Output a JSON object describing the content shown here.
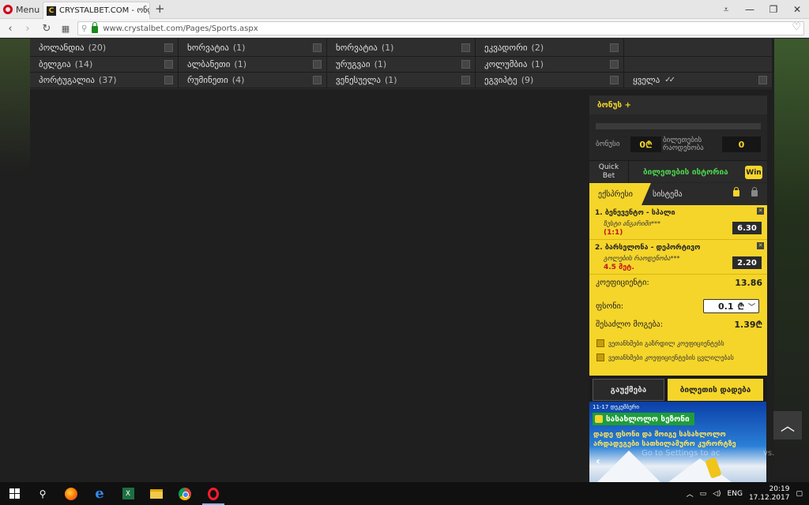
{
  "browser": {
    "menu_label": "Menu",
    "tab_title": "CRYSTALBET.COM - ონლ...",
    "favicon_letter": "C",
    "new_tab": "+",
    "url": "www.crystalbet.com/Pages/Sports.aspx",
    "controls": [
      "⩡",
      "—",
      "❐",
      "✕"
    ]
  },
  "countries": [
    [
      {
        "name": "პოლანდია",
        "count": "(20)"
      },
      {
        "name": "ხორვატია",
        "count": "(1)"
      },
      {
        "name": "ხორვატია",
        "count": "(1)"
      },
      {
        "name": "ეკვადორი",
        "count": "(2)"
      },
      {
        "name": "",
        "count": ""
      }
    ],
    [
      {
        "name": "ბელგია",
        "count": "(14)"
      },
      {
        "name": "ალბანეთი",
        "count": "(1)"
      },
      {
        "name": "ურუგვაი",
        "count": "(1)"
      },
      {
        "name": "კოლუმბია",
        "count": "(1)"
      },
      {
        "name": "",
        "count": ""
      }
    ],
    [
      {
        "name": "პორტუგალია",
        "count": "(37)"
      },
      {
        "name": "რუმინეთი",
        "count": "(4)"
      },
      {
        "name": "ვენესუელა",
        "count": "(1)"
      },
      {
        "name": "ეგვიპტე",
        "count": "(9)"
      },
      {
        "name": "ყველა",
        "count": ""
      }
    ]
  ],
  "slip": {
    "bonus_title": "ბონუს +",
    "bonus_label": "ბონუსი",
    "bonus_value": "0",
    "tickets_label_1": "ბილეთების",
    "tickets_label_2": "რაოდენობა",
    "tickets_value": "0",
    "quick_bet_1": "Quick",
    "quick_bet_2": "Bet",
    "history": "ბილეთების ისტორია",
    "win_badge": "Win",
    "tab_express": "ექსპრესი",
    "tab_system": "სისტემა",
    "tickets": [
      {
        "title": "1. ბენევენტო - სპალი",
        "market": "ზუსტი ანგარიში***",
        "line": "(1:1)",
        "odds": "6.30"
      },
      {
        "title": "2. ბარსელონა - დეპორტივო",
        "market": "გოლების რაოდენობა***",
        "line": "4.5 მეტ.",
        "odds": "2.20"
      }
    ],
    "coef_label": "კოეფიციენტი:",
    "coef_value": "13.86",
    "stake_label": "ფსონი:",
    "stake_value": "0.1",
    "win_label": "შესაძლო მოგება:",
    "win_value": "1.39",
    "currency": "₾",
    "check_1": "ვეთანხმები გაზრდილ კოეფიციენტებს",
    "check_2": "ვეთანხმები კოეფიციენტების ცვლილებას",
    "cancel": "გაუქმება",
    "place": "ბილეთის დადება"
  },
  "banner": {
    "date": "11-17 დეკემბერი",
    "title": "სასახლოლო სეზონი",
    "line1": "დადე ფსონი და მოიგე სასახლოლო",
    "line2": "არდადეგები სათხილამურო კურორტზე"
  },
  "overlay_text": "Go to Settings to ac",
  "overlay_text_2": "vs.",
  "taskbar": {
    "lang": "ENG",
    "time": "20:19",
    "date": "17.12.2017"
  },
  "colors": {
    "accent_yellow": "#f5d52a",
    "history_green": "#4cd64c",
    "line_red": "#c0161b"
  }
}
